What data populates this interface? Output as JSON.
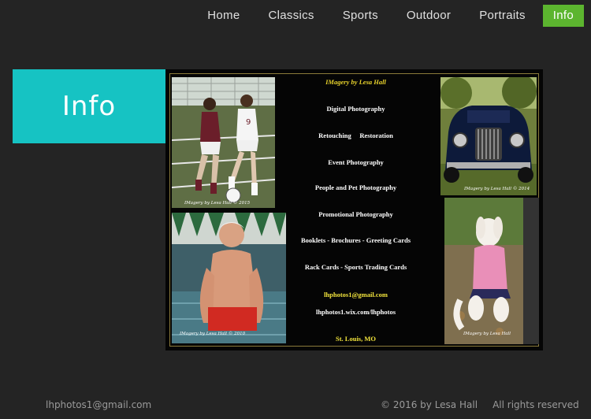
{
  "nav": {
    "items": [
      {
        "label": "Home"
      },
      {
        "label": "Classics"
      },
      {
        "label": "Sports"
      },
      {
        "label": "Outdoor"
      },
      {
        "label": "Portraits"
      },
      {
        "label": "Info"
      }
    ],
    "active_color": "#5cb52f"
  },
  "info_box": {
    "title": "Info",
    "color": "#16c3c3"
  },
  "flyer": {
    "heading": "IMagery by Lesa Hall",
    "services": [
      "Digital Photography",
      "Retouching     Restoration",
      "Event Photography",
      "People and Pet Photography",
      "Promotional Photography",
      "Booklets - Brochures - Greeting Cards",
      "Rack Cards - Sports Trading Cards"
    ],
    "email": "lhphotos1@gmail.com",
    "website": "lhphotos1.wix.com/lhphotos",
    "location": "St. Louis, MO",
    "captions": {
      "soccer": "IMagery by Lesa Hall © 2015",
      "car": "IMagery by Lesa Hall © 2014",
      "swimmer": "IMagery by Lesa Hall © 2010",
      "dog": "IMagery by Lesa Hall"
    }
  },
  "footer": {
    "email": "lhphotos1@gmail.com",
    "copyright": "© 2016 by Lesa Hall     All rights reserved     C"
  }
}
